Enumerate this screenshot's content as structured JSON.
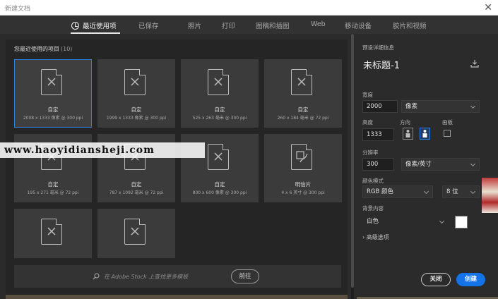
{
  "window": {
    "title": "新建文档",
    "close_glyph": "✕"
  },
  "tabs": [
    {
      "label": "最近使用项",
      "active": true
    },
    {
      "label": "已保存"
    },
    {
      "label": "照片"
    },
    {
      "label": "打印"
    },
    {
      "label": "图稿和插图"
    },
    {
      "label": "Web"
    },
    {
      "label": "移动设备"
    },
    {
      "label": "胶片和视频"
    }
  ],
  "recent": {
    "heading": "您最近使用的项目",
    "count": "(10)",
    "items": [
      {
        "name": "自定",
        "size": "2008 x 1333 像素 @ 300 ppi",
        "selected": true
      },
      {
        "name": "自定",
        "size": "1999 x 1333 像素 @ 300 ppi"
      },
      {
        "name": "自定",
        "size": "525 x 263 毫米 @ 300 ppi"
      },
      {
        "name": "自定",
        "size": "260 x 184 毫米 @ 72 ppi"
      },
      {
        "name": "自定",
        "size": "195 x 271 毫米 @ 72 ppi"
      },
      {
        "name": "自定",
        "size": "787 x 1092 毫米 @ 72 ppi"
      },
      {
        "name": "自定",
        "size": "800 x 600 像素 @ 300 ppi"
      },
      {
        "name": "明信片",
        "size": "4 x 6 英寸 @ 300 ppi"
      },
      {
        "name": "",
        "size": ""
      },
      {
        "name": "",
        "size": ""
      }
    ]
  },
  "search": {
    "placeholder": "在 Adobe Stock 上查找更多模板",
    "go_label": "前往"
  },
  "preset": {
    "section_label": "预设详细信息",
    "doc_name": "未标题-1",
    "width_label": "宽度",
    "width_value": "2000",
    "width_unit": "像素",
    "height_label": "高度",
    "height_value": "1333",
    "orientation_label": "方向",
    "artboard_label": "画板",
    "resolution_label": "分辨率",
    "resolution_value": "300",
    "resolution_unit": "像素/英寸",
    "color_mode_label": "颜色模式",
    "color_mode_value": "RGB 颜色",
    "bit_depth_value": "8 位",
    "background_label": "背景内容",
    "background_value": "白色",
    "advanced_label": "高级选项",
    "advanced_glyph": "›"
  },
  "buttons": {
    "close_label": "关闭",
    "create_label": "创建"
  },
  "watermark": "www.haoyidiansheji.com",
  "colors": {
    "accent": "#1473e6",
    "selected_outline": "#2d7fe0",
    "panel": "#2b2b2b"
  }
}
